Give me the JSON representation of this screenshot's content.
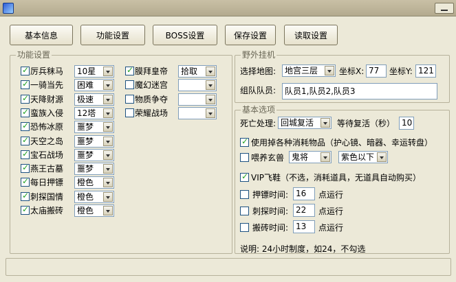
{
  "toolbar": [
    "基本信息",
    "功能设置",
    "BOSS设置",
    "保存设置",
    "读取设置"
  ],
  "func_group": {
    "title": "功能设置",
    "left_items": [
      {
        "label": "厉兵秣马",
        "checked": true,
        "value": "10星"
      },
      {
        "label": "一骑当先",
        "checked": true,
        "value": "困难"
      },
      {
        "label": "天降财源",
        "checked": true,
        "value": "极速"
      },
      {
        "label": "蛮族入侵",
        "checked": true,
        "value": "12塔"
      },
      {
        "label": "恐怖冰原",
        "checked": true,
        "value": "噩梦"
      },
      {
        "label": "天空之岛",
        "checked": true,
        "value": "噩梦"
      },
      {
        "label": "宝石战场",
        "checked": true,
        "value": "噩梦"
      },
      {
        "label": "燕王古墓",
        "checked": true,
        "value": "噩梦"
      },
      {
        "label": "每日押镖",
        "checked": true,
        "value": "橙色"
      },
      {
        "label": "刺探国情",
        "checked": true,
        "value": "橙色"
      },
      {
        "label": "太庙搬砖",
        "checked": true,
        "value": "橙色"
      }
    ],
    "right_items": [
      {
        "label": "膜拜皇帝",
        "checked": true,
        "value": "拾取"
      },
      {
        "label": "魔幻迷宫",
        "checked": false,
        "value": ""
      },
      {
        "label": "物质争夺",
        "checked": false,
        "value": ""
      },
      {
        "label": "荣耀战场",
        "checked": false,
        "value": ""
      }
    ]
  },
  "field": {
    "title": "野外挂机",
    "map_label": "选择地图:",
    "map_value": "地宫三层",
    "x_label": "坐标X:",
    "x_value": "77",
    "y_label": "坐标Y:",
    "y_value": "121",
    "team_label": "组队队员:",
    "team_value": "队员1,队员2,队员3"
  },
  "basic": {
    "title": "基本选项",
    "death_label": "死亡处理:",
    "death_value": "回城复活",
    "wait_label": "等待复活（秒）",
    "wait_value": "10",
    "use_items_label": "使用掉各种消耗物品（护心镜、暗器、幸运转盘）",
    "feed_label": "喂养玄兽",
    "feed_value1": "鬼将",
    "feed_value2": "紫色以下",
    "vip_label": "VIP飞鞋（不选，消耗道具，无道具自动购买）",
    "escort_label": "押镖时间:",
    "escort_value": "16",
    "spy_label": "刺探时间:",
    "spy_value": "22",
    "brick_label": "搬砖时间:",
    "brick_value": "13",
    "run_suffix": "点运行",
    "note": "说明: 24小时制度，如24，不勾选"
  },
  "colors": {
    "window_bg": "#ece9d8",
    "check": "#21a121",
    "input_border": "#7f9db9"
  }
}
